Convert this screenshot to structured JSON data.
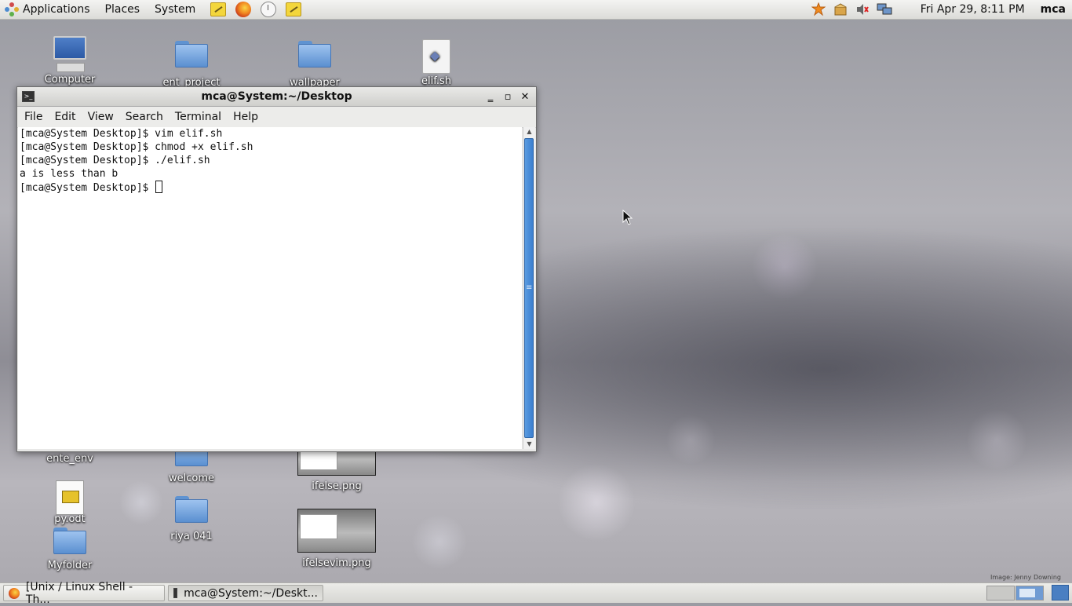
{
  "top_panel": {
    "menus": [
      "Applications",
      "Places",
      "System"
    ],
    "clock": "Fri Apr 29,  8:11 PM",
    "user": "mca"
  },
  "desktop_icons": {
    "computer": "Computer",
    "ent_project": "ent_project",
    "wallpaper": "wallpaper",
    "elif_sh": "elif.sh",
    "ente_env": "ente_env",
    "welcome": "welcome",
    "ifelse_png": "ifelse.png",
    "py_odt": "py.odt",
    "riya": "riya 041",
    "ifelsevim_png": "ifelsevim.png",
    "myfolder": "Myfolder"
  },
  "terminal": {
    "title": "mca@System:~/Desktop",
    "menu": [
      "File",
      "Edit",
      "View",
      "Search",
      "Terminal",
      "Help"
    ],
    "lines": [
      "[mca@System Desktop]$ vim elif.sh",
      "[mca@System Desktop]$ chmod +x elif.sh",
      "[mca@System Desktop]$ ./elif.sh",
      "a is less than b",
      "[mca@System Desktop]$ "
    ]
  },
  "taskbar": {
    "tasks": [
      "[Unix / Linux Shell - Th...",
      "mca@System:~/Deskt..."
    ]
  },
  "wallpaper_credit": "Image: Jenny Downing"
}
